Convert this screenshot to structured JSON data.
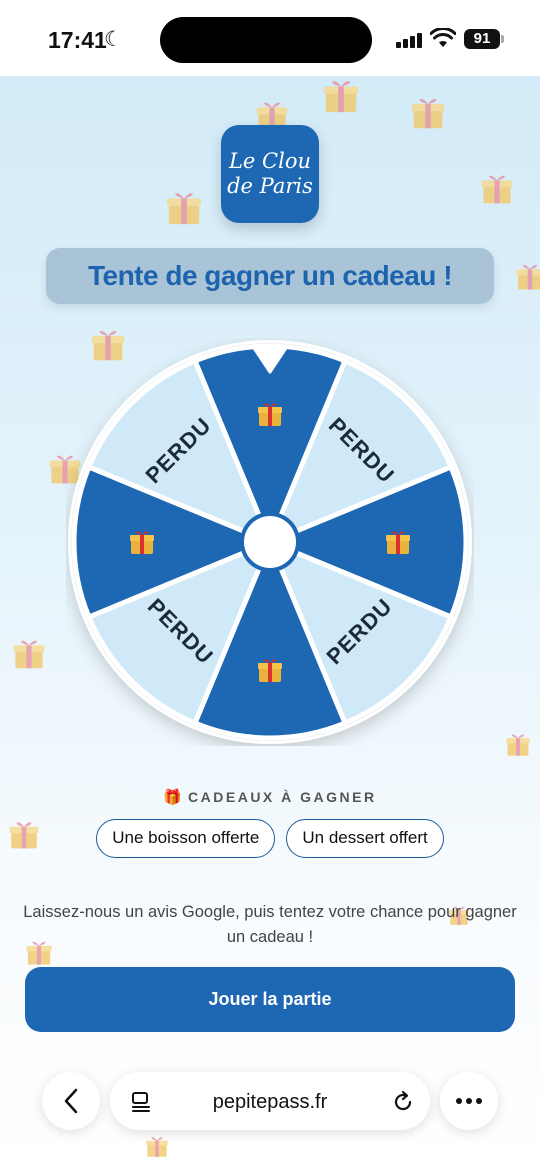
{
  "status_bar": {
    "time": "17:41",
    "battery": "91"
  },
  "page": {
    "logo": {
      "line1": "Le Clou",
      "line2": "de Paris"
    },
    "headline": "Tente de gagner un cadeau !",
    "wheel": {
      "segments": [
        {
          "type": "gift",
          "icon": "gift-icon"
        },
        {
          "type": "text",
          "label": "PERDU"
        },
        {
          "type": "gift",
          "icon": "gift-icon"
        },
        {
          "type": "text",
          "label": "PERDU"
        },
        {
          "type": "gift",
          "icon": "gift-icon"
        },
        {
          "type": "text",
          "label": "PERDU"
        },
        {
          "type": "gift",
          "icon": "gift-icon"
        },
        {
          "type": "text",
          "label": "PERDU"
        }
      ],
      "colors": {
        "dark": "#1d67b3",
        "light": "#cfe9f8",
        "border": "#ffffff"
      }
    },
    "prizes": {
      "label": "CADEAUX À GAGNER",
      "icon": "gift-icon",
      "items": [
        "Une boisson offerte",
        "Un dessert offert"
      ]
    },
    "instruction": "Laissez-nous un avis Google, puis tentez votre chance pour gagner un cadeau !",
    "play_button": "Jouer la partie"
  },
  "browser": {
    "url": "pepitepass.fr"
  }
}
